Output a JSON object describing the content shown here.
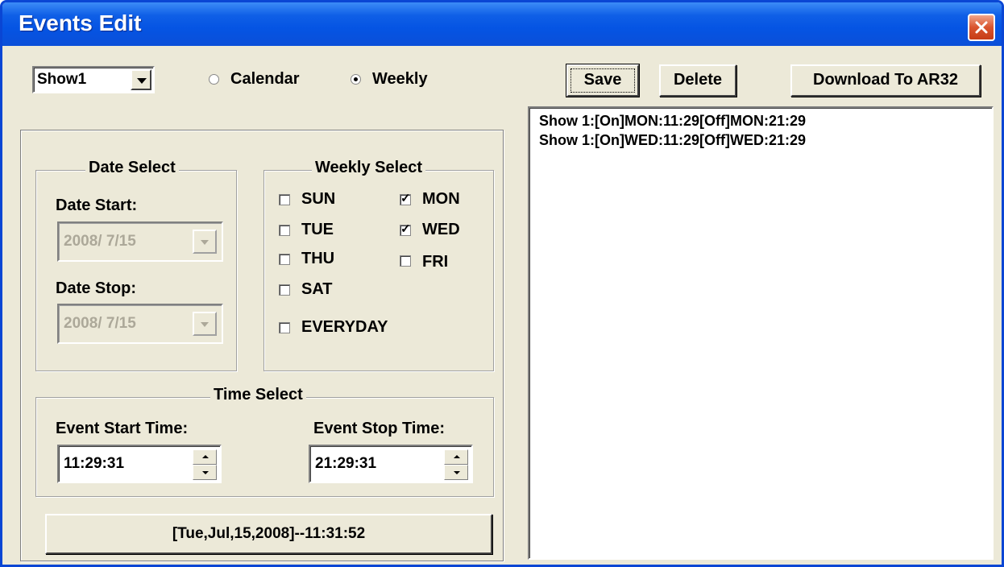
{
  "window": {
    "title": "Events Edit"
  },
  "show_select": {
    "value": "Show1"
  },
  "mode": {
    "calendar_label": "Calendar",
    "weekly_label": "Weekly",
    "selected": "Weekly"
  },
  "toolbar": {
    "save_label": "Save",
    "delete_label": "Delete",
    "download_label": "Download To AR32"
  },
  "event_list": [
    "Show 1:[On]MON:11:29[Off]MON:21:29",
    "Show 1:[On]WED:11:29[Off]WED:21:29"
  ],
  "date_select": {
    "legend": "Date Select",
    "start_label": "Date Start:",
    "start_value": "2008/ 7/15",
    "stop_label": "Date Stop:",
    "stop_value": "2008/ 7/15"
  },
  "weekly_select": {
    "legend": "Weekly Select",
    "days": {
      "sun": {
        "label": "SUN",
        "checked": false
      },
      "mon": {
        "label": "MON",
        "checked": true
      },
      "tue": {
        "label": "TUE",
        "checked": false
      },
      "wed": {
        "label": "WED",
        "checked": true
      },
      "thu": {
        "label": "THU",
        "checked": false
      },
      "fri": {
        "label": "FRI",
        "checked": false
      },
      "sat": {
        "label": "SAT",
        "checked": false
      },
      "everyday": {
        "label": "EVERYDAY",
        "checked": false
      }
    }
  },
  "time_select": {
    "legend": "Time Select",
    "start_label": "Event Start Time:",
    "start_value": "11:29:31",
    "stop_label": "Event Stop Time:",
    "stop_value": "21:29:31"
  },
  "status": {
    "datetime": "[Tue,Jul,15,2008]--11:31:52"
  }
}
